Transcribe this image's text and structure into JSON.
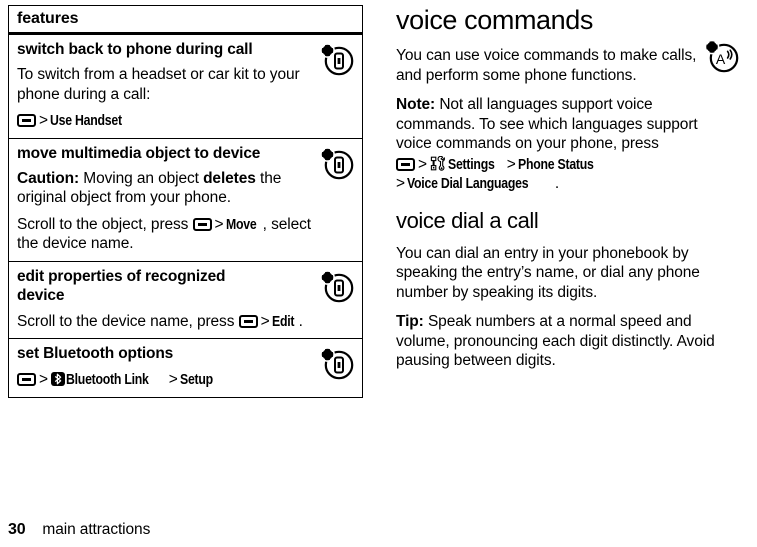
{
  "page": {
    "folio": "30",
    "running_head": "main attractions"
  },
  "features_table": {
    "header": "features",
    "rows": [
      {
        "title": "switch back to phone during call",
        "icon": "bluetooth-device-icon",
        "paragraphs": [
          {
            "type": "text",
            "text": "To switch from a headset or car kit to your phone during a call:"
          }
        ],
        "path": {
          "key": "menu-key-icon",
          "sep1": ">",
          "item1": "Use Handset"
        }
      },
      {
        "title": "move multimedia object to device",
        "icon": "bluetooth-device-icon",
        "caution_label": "Caution:",
        "caution_text_a": " Moving an object ",
        "caution_bold": "deletes",
        "caution_text_b": " the original object from your phone.",
        "scroll_text_a": "Scroll to the object, press ",
        "scroll_sep": ">",
        "scroll_cmd": "Move",
        "scroll_text_b": ", select the device name."
      },
      {
        "title": "edit properties of recognized device",
        "icon": "bluetooth-device-icon",
        "scroll_text_a": "Scroll to the device name, press ",
        "scroll_sep": ">",
        "scroll_cmd": "Edit",
        "scroll_text_b": "."
      },
      {
        "title": "set Bluetooth options",
        "icon": "bluetooth-device-icon",
        "path": {
          "key": "menu-key-icon",
          "sep1": ">",
          "bt_icon": "bluetooth-icon",
          "item1": "Bluetooth Link",
          "sep2": ">",
          "item2": "Setup"
        }
      }
    ]
  },
  "right_column": {
    "section1_title": "voice commands",
    "section1_icon": "voice-recognition-icon",
    "section1_p1": "You can use voice commands to make calls, and perform some phone functions.",
    "note_label": "Note:",
    "note_text": " Not all languages support voice commands. To see which languages support voice commands on your phone, press",
    "note_path": {
      "key": "menu-key-icon",
      "sep1": ">",
      "tools_icon": "settings-tools-icon",
      "item1": "Settings",
      "sep2": ">",
      "item2": "Phone Status",
      "sep3": ">",
      "item3": "Voice Dial Languages",
      "period": "."
    },
    "section2_title": "voice dial a call",
    "section2_p1": "You can dial an entry in your phonebook by speaking the entry’s name, or dial any phone number by speaking its digits.",
    "tip_label": "Tip:",
    "tip_text": " Speak numbers at a normal speed and volume, pronouncing each digit distinctly. Avoid pausing between digits."
  },
  "colors": {
    "text": "#000000",
    "background": "#ffffff",
    "rule": "#000000"
  }
}
